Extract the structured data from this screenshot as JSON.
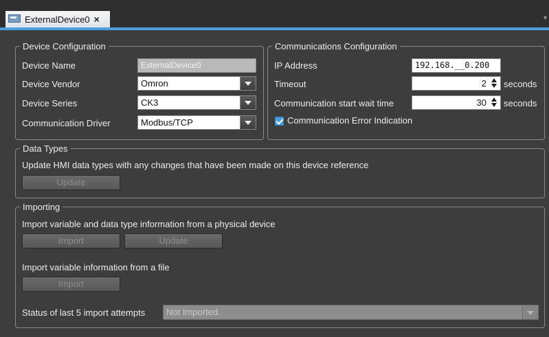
{
  "tab": {
    "title": "ExternalDevice0",
    "close": "×"
  },
  "device_config": {
    "legend": "Device Configuration",
    "name_label": "Device Name",
    "name_value": "ExternalDevice0",
    "vendor_label": "Device Vendor",
    "vendor_value": "Omron",
    "series_label": "Device Series",
    "series_value": "CK3",
    "driver_label": "Communication Driver",
    "driver_value": "Modbus/TCP"
  },
  "comm_config": {
    "legend": "Communications Configuration",
    "ip_label": "IP Address",
    "ip_value": "192.168.__0.200",
    "timeout_label": "Timeout",
    "timeout_value": "2",
    "timeout_unit": "seconds",
    "wait_label": "Communication start wait time",
    "wait_value": "30",
    "wait_unit": "seconds",
    "error_indication_label": "Communication Error Indication",
    "error_indication_checked": true
  },
  "data_types": {
    "legend": "Data Types",
    "description": "Update HMI data types with any changes that have been made on this device reference",
    "update_button": "Update"
  },
  "importing": {
    "legend": "Importing",
    "physical_description": "Import variable and data type information from a physical device",
    "import_button": "Import",
    "update_button": "Update",
    "file_description": "Import variable information from a file",
    "file_import_button": "Import",
    "status_label": "Status of last 5 import attempts",
    "status_value": "Not Imported."
  },
  "colors": {
    "background": "#3d3d3d",
    "accent": "#4a9fe0",
    "tab_background": "#dfe4ea"
  }
}
